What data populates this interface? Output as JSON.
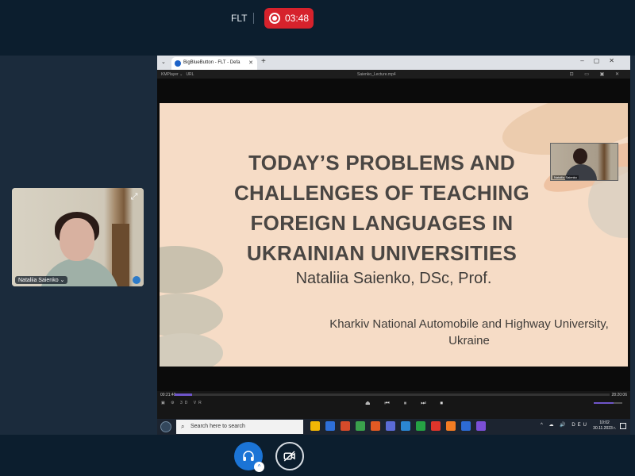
{
  "header": {
    "meeting_name": "FLT",
    "recording_time": "03:48",
    "record_icon": "record-icon"
  },
  "webcam": {
    "name": "Nataliia Saienko",
    "expand_icon": "expand-icon",
    "mic_icon": "microphone-icon"
  },
  "browser": {
    "tab_title": "BigBlueButton - FLT - Defa",
    "new_tab": "+",
    "menu": "⌄",
    "controls": "–▢✕"
  },
  "player": {
    "app_name": "KMPlayer",
    "menu_url": "URL",
    "file_name": "Saienko_Lecture.mp4",
    "time_elapsed": "00:21:40",
    "time_total": "28:20:06",
    "progress_fraction": 0.04,
    "volume_fraction": 0.7,
    "top_right": "⊡ ▭ ▣ ✕",
    "bottom_left": "▣ ⚙ 3D VR",
    "transport": "⏏ ⏮ ⏸ ⏭ ⏹"
  },
  "slide": {
    "title_lines": [
      "TODAY’S PROBLEMS AND",
      "CHALLENGES OF TEACHING",
      "FOREIGN LANGUAGES IN",
      "UKRAINIAN UNIVERSITIES"
    ],
    "author": "Nataliia Saienko, DSc, Prof.",
    "institution_line1": "Kharkiv National Automobile and Highway University,",
    "institution_line2": "Ukraine",
    "pip_name": "Nataliia Saienko"
  },
  "taskbar": {
    "search_placeholder": "Search here to search",
    "tray": "^ ☁ 🔊 DEU",
    "clock_time": "10:02",
    "clock_date": "30.11.2023 r.",
    "app_colors": [
      "#f2b705",
      "#2e6fd8",
      "#d64b2a",
      "#3aa04c",
      "#e15a23",
      "#5b6cd6",
      "#2b87d3",
      "#25a244",
      "#e0352b",
      "#f27c23",
      "#2d6bd4",
      "#7b4fd6"
    ]
  },
  "controls": {
    "audio_icon": "headphones-icon",
    "audio_badge": "^",
    "camera_icon": "camera-off-icon"
  }
}
